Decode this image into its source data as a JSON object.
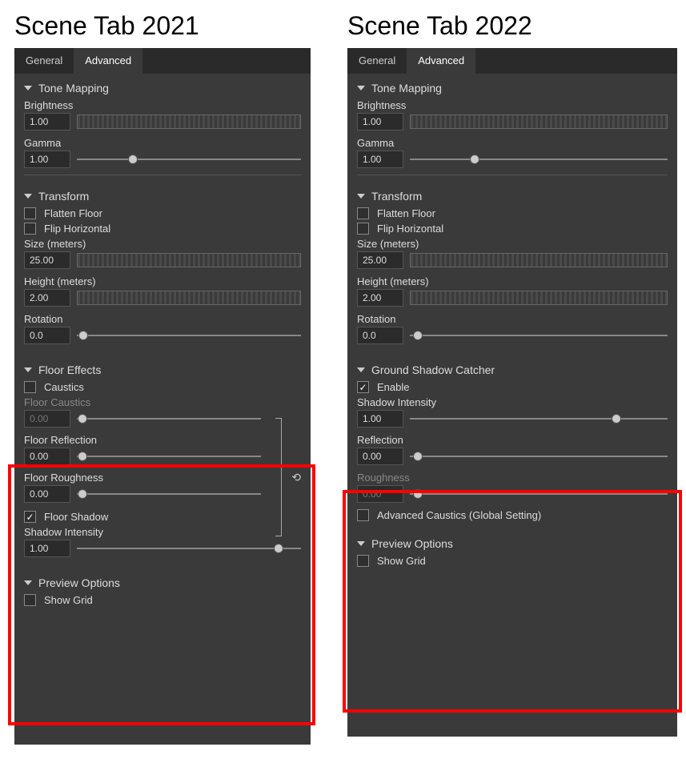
{
  "heading_2021": "Scene Tab 2021",
  "heading_2022": "Scene Tab 2022",
  "tabs": {
    "general": "General",
    "advanced": "Advanced"
  },
  "tone_mapping": {
    "title": "Tone Mapping",
    "brightness_label": "Brightness",
    "brightness_value": "1.00",
    "gamma_label": "Gamma",
    "gamma_value": "1.00"
  },
  "transform": {
    "title": "Transform",
    "flatten_floor": "Flatten Floor",
    "flip_horizontal": "Flip Horizontal",
    "size_label": "Size (meters)",
    "size_value": "25.00",
    "height_label": "Height (meters)",
    "height_value": "2.00",
    "rotation_label": "Rotation",
    "rotation_value": "0.0"
  },
  "floor_effects_2021": {
    "title": "Floor Effects",
    "caustics": "Caustics",
    "floor_caustics_label": "Floor Caustics",
    "floor_caustics_value": "0.00",
    "floor_reflection_label": "Floor Reflection",
    "floor_reflection_value": "0.00",
    "floor_roughness_label": "Floor Roughness",
    "floor_roughness_value": "0.00",
    "floor_shadow": "Floor Shadow",
    "shadow_intensity_label": "Shadow Intensity",
    "shadow_intensity_value": "1.00"
  },
  "ground_shadow_2022": {
    "title": "Ground Shadow Catcher",
    "enable": "Enable",
    "shadow_intensity_label": "Shadow Intensity",
    "shadow_intensity_value": "1.00",
    "reflection_label": "Reflection",
    "reflection_value": "0.00",
    "roughness_label": "Roughness",
    "roughness_value": "0.00",
    "adv_caustics": "Advanced Caustics (Global Setting)"
  },
  "preview": {
    "title": "Preview Options",
    "show_grid": "Show Grid"
  }
}
